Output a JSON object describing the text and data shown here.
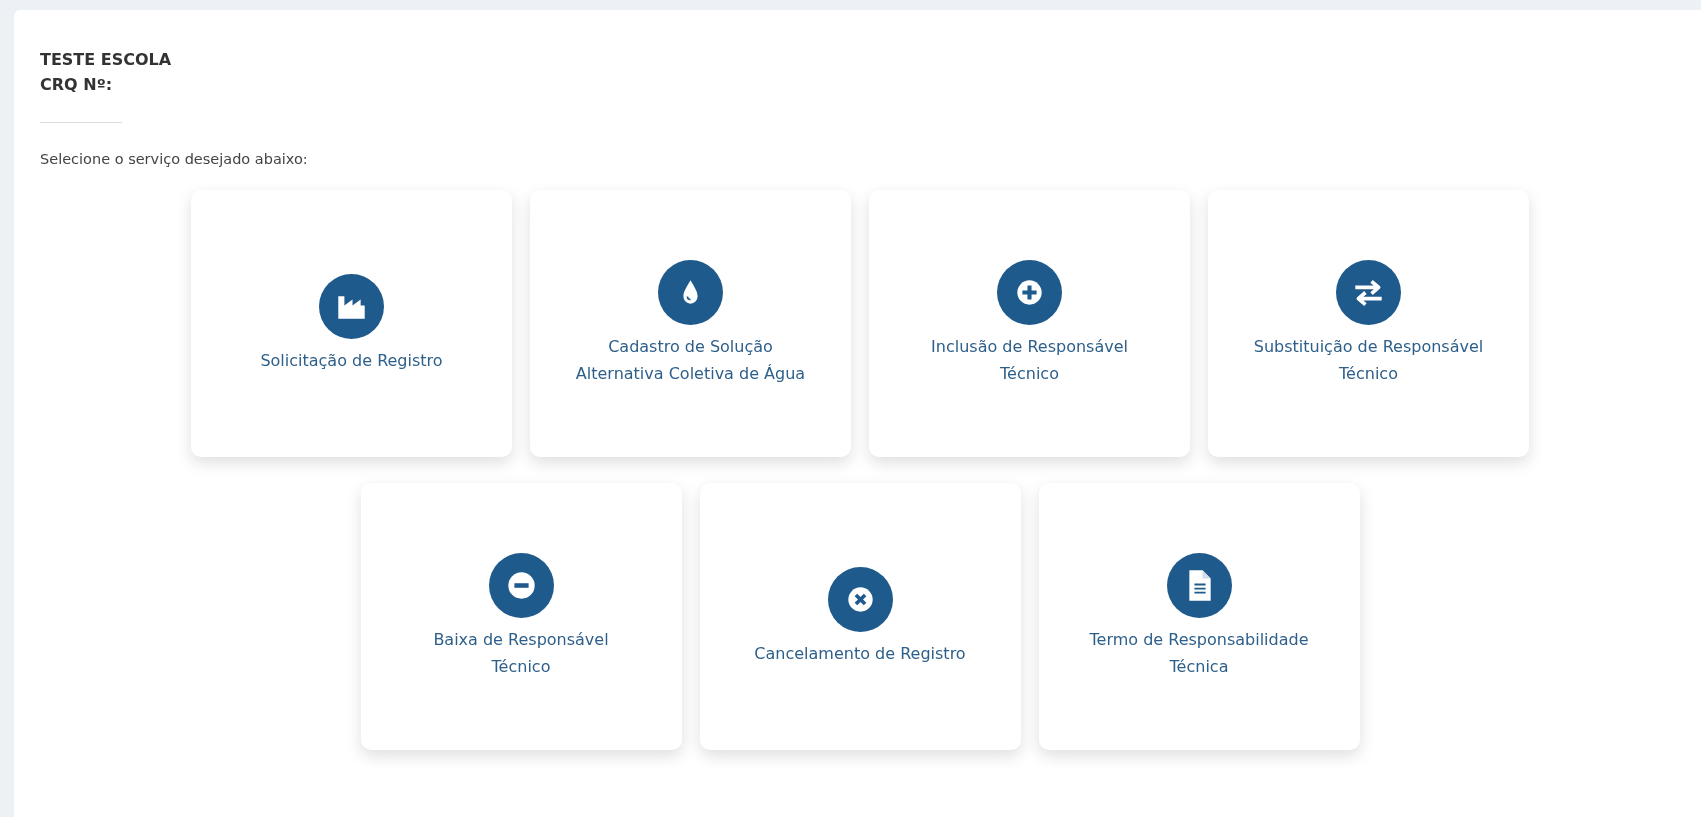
{
  "header": {
    "name": "TESTE ESCOLA",
    "crq": "CRQ Nº:"
  },
  "instruction": "Selecione o serviço desejado abaixo:",
  "services": [
    {
      "kind": "factory",
      "lines": [
        "Solicitação de Registro"
      ]
    },
    {
      "kind": "drop",
      "lines": [
        "Cadastro de Solução",
        "Alternativa Coletiva de Água"
      ]
    },
    {
      "kind": "plus",
      "lines": [
        "Inclusão de Responsável",
        "Técnico"
      ]
    },
    {
      "kind": "swap",
      "lines": [
        "Substituição de Responsável",
        "Técnico"
      ]
    },
    {
      "kind": "minus",
      "lines": [
        "Baixa de Responsável",
        "Técnico"
      ]
    },
    {
      "kind": "cross",
      "lines": [
        "Cancelamento de Registro"
      ]
    },
    {
      "kind": "document",
      "lines": [
        "Termo de Responsabilidade",
        "Técnica"
      ]
    }
  ]
}
